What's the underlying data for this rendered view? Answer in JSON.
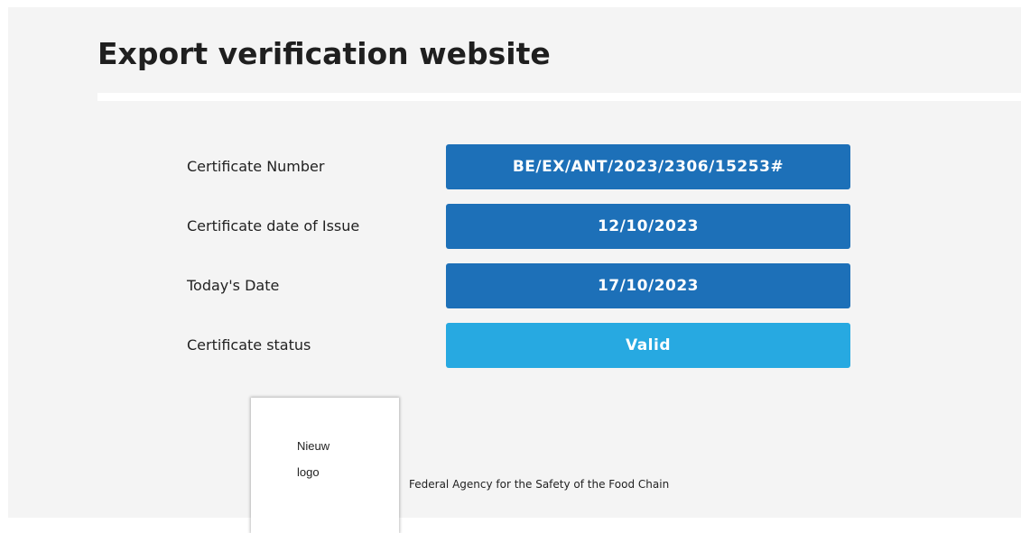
{
  "page": {
    "title": "Export verification website"
  },
  "certificate": {
    "fields": [
      {
        "label": "Certificate Number",
        "value": "BE/EX/ANT/2023/2306/15253#",
        "color": "#1d70b8"
      },
      {
        "label": "Certificate date of Issue",
        "value": "12/10/2023",
        "color": "#1d70b8"
      },
      {
        "label": "Today's Date",
        "value": "17/10/2023",
        "color": "#1d70b8"
      },
      {
        "label": "Certificate status",
        "value": "Valid",
        "color": "#27a9e1"
      }
    ]
  },
  "footer": {
    "logo_line1": "Nieuw",
    "logo_line2": "logo",
    "agency_name": "Federal Agency for the Safety of the Food Chain"
  }
}
